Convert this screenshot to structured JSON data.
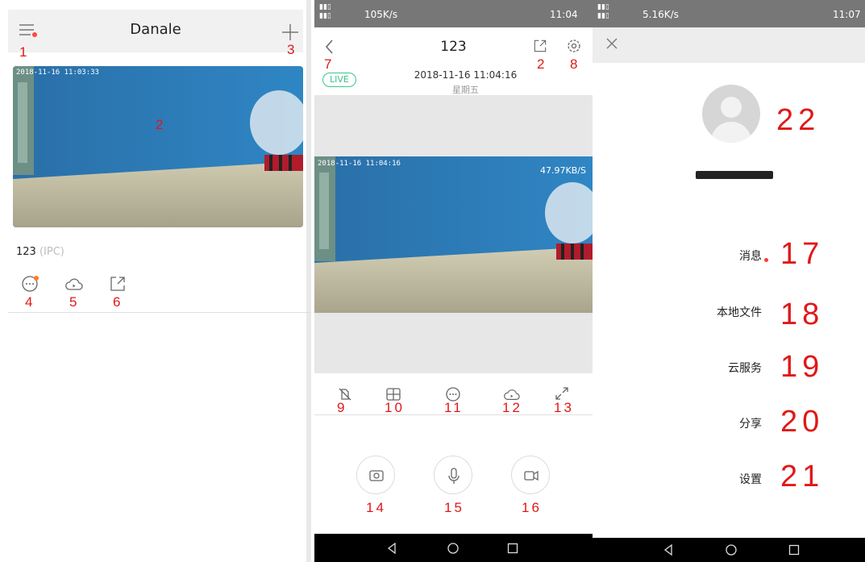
{
  "home": {
    "title": "Danale",
    "device_name": "123",
    "device_type": "(IPC)",
    "video_timestamp": "2018-11-16 11:03:33",
    "icons": [
      "menu-icon",
      "plus-icon",
      "message-icon",
      "cloud-icon",
      "share-icon"
    ]
  },
  "live": {
    "status_speed": "105K/s",
    "status_time": "11:04",
    "title": "123",
    "live_badge": "LIVE",
    "datetime": "2018-11-16 11:04:16",
    "weekday": "星期五",
    "video_timestamp": "2018-11-16 11:04:16",
    "rate": "47.97KB/S",
    "icons": [
      "back-icon",
      "share-icon",
      "settings-icon",
      "mute-icon",
      "split-screen-icon",
      "message-icon",
      "cloud-icon",
      "fullscreen-icon",
      "camera-icon",
      "microphone-icon",
      "record-icon"
    ]
  },
  "drawer": {
    "status_speed": "5.16K/s",
    "status_time": "11:07",
    "menu": {
      "messages": "消息",
      "local_files": "本地文件",
      "cloud_service": "云服务",
      "share": "分享",
      "settings": "设置"
    },
    "icons": [
      "close-icon",
      "avatar-icon"
    ]
  },
  "annotations": {
    "a1": "1",
    "a2": "2",
    "a3": "3",
    "a4": "4",
    "a5": "5",
    "a6": "6",
    "a7": "7",
    "a8": "8",
    "a9": "9",
    "a10": "10",
    "a11": "11",
    "a12": "12",
    "a13": "13",
    "a14": "14",
    "a15": "15",
    "a16": "16",
    "a17": "17",
    "a18": "18",
    "a19": "19",
    "a20": "20",
    "a21": "21",
    "a22": "22"
  },
  "colors": {
    "annotation": "#e01818",
    "live_green": "#3cc48b",
    "notify_red": "#ff4a3d",
    "status_bar": "#777777"
  }
}
